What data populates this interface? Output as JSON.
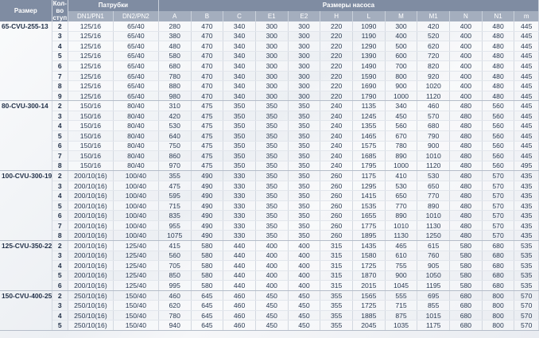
{
  "header": {
    "size": "Размер",
    "stages": "Кол-во ступ",
    "nozzles": "Патрубки",
    "dims": "Размеры насоса",
    "cols": [
      "DN1/PN1",
      "DN2/PN2",
      "A",
      "B",
      "C",
      "E1",
      "E2",
      "H",
      "L",
      "M",
      "M1",
      "N",
      "N1",
      "m"
    ]
  },
  "groups": [
    {
      "size": "65-CVU-255-13",
      "rows": [
        [
          "2",
          "125/16",
          "65/40",
          "280",
          "470",
          "340",
          "300",
          "300",
          "220",
          "1090",
          "300",
          "420",
          "400",
          "480",
          "445"
        ],
        [
          "3",
          "125/16",
          "65/40",
          "380",
          "470",
          "340",
          "300",
          "300",
          "220",
          "1190",
          "400",
          "520",
          "400",
          "480",
          "445"
        ],
        [
          "4",
          "125/16",
          "65/40",
          "480",
          "470",
          "340",
          "300",
          "300",
          "220",
          "1290",
          "500",
          "620",
          "400",
          "480",
          "445"
        ],
        [
          "5",
          "125/16",
          "65/40",
          "580",
          "470",
          "340",
          "300",
          "300",
          "220",
          "1390",
          "600",
          "720",
          "400",
          "480",
          "445"
        ],
        [
          "6",
          "125/16",
          "65/40",
          "680",
          "470",
          "340",
          "300",
          "300",
          "220",
          "1490",
          "700",
          "820",
          "400",
          "480",
          "445"
        ],
        [
          "7",
          "125/16",
          "65/40",
          "780",
          "470",
          "340",
          "300",
          "300",
          "220",
          "1590",
          "800",
          "920",
          "400",
          "480",
          "445"
        ],
        [
          "8",
          "125/16",
          "65/40",
          "880",
          "470",
          "340",
          "300",
          "300",
          "220",
          "1690",
          "900",
          "1020",
          "400",
          "480",
          "445"
        ],
        [
          "9",
          "125/16",
          "65/40",
          "980",
          "470",
          "340",
          "300",
          "300",
          "220",
          "1790",
          "1000",
          "1120",
          "400",
          "480",
          "445"
        ]
      ]
    },
    {
      "size": "80-CVU-300-14",
      "rows": [
        [
          "2",
          "150/16",
          "80/40",
          "310",
          "475",
          "350",
          "350",
          "350",
          "240",
          "1135",
          "340",
          "460",
          "480",
          "560",
          "445"
        ],
        [
          "3",
          "150/16",
          "80/40",
          "420",
          "475",
          "350",
          "350",
          "350",
          "240",
          "1245",
          "450",
          "570",
          "480",
          "560",
          "445"
        ],
        [
          "4",
          "150/16",
          "80/40",
          "530",
          "475",
          "350",
          "350",
          "350",
          "240",
          "1355",
          "560",
          "680",
          "480",
          "560",
          "445"
        ],
        [
          "5",
          "150/16",
          "80/40",
          "640",
          "475",
          "350",
          "350",
          "350",
          "240",
          "1465",
          "670",
          "790",
          "480",
          "560",
          "445"
        ],
        [
          "6",
          "150/16",
          "80/40",
          "750",
          "475",
          "350",
          "350",
          "350",
          "240",
          "1575",
          "780",
          "900",
          "480",
          "560",
          "445"
        ],
        [
          "7",
          "150/16",
          "80/40",
          "860",
          "475",
          "350",
          "350",
          "350",
          "240",
          "1685",
          "890",
          "1010",
          "480",
          "560",
          "445"
        ],
        [
          "8",
          "150/16",
          "80/40",
          "970",
          "475",
          "350",
          "350",
          "350",
          "240",
          "1795",
          "1000",
          "1120",
          "480",
          "560",
          "495"
        ]
      ]
    },
    {
      "size": "100-CVU-300-19",
      "rows": [
        [
          "2",
          "200/10(16)",
          "100/40",
          "355",
          "490",
          "330",
          "350",
          "350",
          "260",
          "1175",
          "410",
          "530",
          "480",
          "570",
          "435"
        ],
        [
          "3",
          "200/10(16)",
          "100/40",
          "475",
          "490",
          "330",
          "350",
          "350",
          "260",
          "1295",
          "530",
          "650",
          "480",
          "570",
          "435"
        ],
        [
          "4",
          "200/10(16)",
          "100/40",
          "595",
          "490",
          "330",
          "350",
          "350",
          "260",
          "1415",
          "650",
          "770",
          "480",
          "570",
          "435"
        ],
        [
          "5",
          "200/10(16)",
          "100/40",
          "715",
          "490",
          "330",
          "350",
          "350",
          "260",
          "1535",
          "770",
          "890",
          "480",
          "570",
          "435"
        ],
        [
          "6",
          "200/10(16)",
          "100/40",
          "835",
          "490",
          "330",
          "350",
          "350",
          "260",
          "1655",
          "890",
          "1010",
          "480",
          "570",
          "435"
        ],
        [
          "7",
          "200/10(16)",
          "100/40",
          "955",
          "490",
          "330",
          "350",
          "350",
          "260",
          "1775",
          "1010",
          "1130",
          "480",
          "570",
          "435"
        ],
        [
          "8",
          "200/10(16)",
          "100/40",
          "1075",
          "490",
          "330",
          "350",
          "350",
          "260",
          "1895",
          "1130",
          "1250",
          "480",
          "570",
          "435"
        ]
      ]
    },
    {
      "size": "125-CVU-350-22",
      "rows": [
        [
          "2",
          "200/10(16)",
          "125/40",
          "415",
          "580",
          "440",
          "400",
          "400",
          "315",
          "1435",
          "465",
          "615",
          "580",
          "680",
          "535"
        ],
        [
          "3",
          "200/10(16)",
          "125/40",
          "560",
          "580",
          "440",
          "400",
          "400",
          "315",
          "1580",
          "610",
          "760",
          "580",
          "680",
          "535"
        ],
        [
          "4",
          "200/10(16)",
          "125/40",
          "705",
          "580",
          "440",
          "400",
          "400",
          "315",
          "1725",
          "755",
          "905",
          "580",
          "680",
          "535"
        ],
        [
          "5",
          "200/10(16)",
          "125/40",
          "850",
          "580",
          "440",
          "400",
          "400",
          "315",
          "1870",
          "900",
          "1050",
          "580",
          "680",
          "535"
        ],
        [
          "6",
          "200/10(16)",
          "125/40",
          "995",
          "580",
          "440",
          "400",
          "400",
          "315",
          "2015",
          "1045",
          "1195",
          "580",
          "680",
          "535"
        ]
      ]
    },
    {
      "size": "150-CVU-400-25",
      "rows": [
        [
          "2",
          "250/10(16)",
          "150/40",
          "460",
          "645",
          "460",
          "450",
          "450",
          "355",
          "1565",
          "555",
          "695",
          "680",
          "800",
          "570"
        ],
        [
          "3",
          "250/10(16)",
          "150/40",
          "620",
          "645",
          "460",
          "450",
          "450",
          "355",
          "1725",
          "715",
          "855",
          "680",
          "800",
          "570"
        ],
        [
          "4",
          "250/10(16)",
          "150/40",
          "780",
          "645",
          "460",
          "450",
          "450",
          "355",
          "1885",
          "875",
          "1015",
          "680",
          "800",
          "570"
        ],
        [
          "5",
          "250/10(16)",
          "150/40",
          "940",
          "645",
          "460",
          "450",
          "450",
          "355",
          "2045",
          "1035",
          "1175",
          "680",
          "800",
          "570"
        ]
      ]
    }
  ]
}
